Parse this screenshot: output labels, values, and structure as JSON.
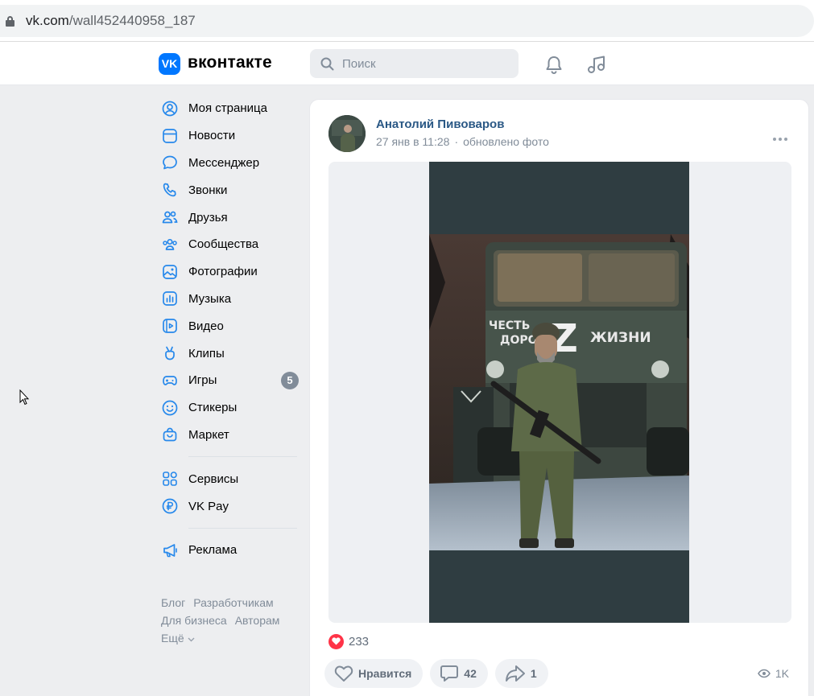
{
  "browser": {
    "url_host": "vk.com",
    "url_path": "/wall452440958_187"
  },
  "header": {
    "logo_letter": "VK",
    "brand": "вконтакте",
    "search_placeholder": "Поиск",
    "accent_color": "#0077ff"
  },
  "sidebar": {
    "items": [
      {
        "label": "Моя страница",
        "icon": "user-circle-icon"
      },
      {
        "label": "Новости",
        "icon": "newsfeed-icon"
      },
      {
        "label": "Мессенджер",
        "icon": "message-icon"
      },
      {
        "label": "Звонки",
        "icon": "phone-icon"
      },
      {
        "label": "Друзья",
        "icon": "friends-icon"
      },
      {
        "label": "Сообщества",
        "icon": "communities-icon"
      },
      {
        "label": "Фотографии",
        "icon": "photo-icon"
      },
      {
        "label": "Музыка",
        "icon": "music-icon"
      },
      {
        "label": "Видео",
        "icon": "video-icon"
      },
      {
        "label": "Клипы",
        "icon": "clips-icon"
      },
      {
        "label": "Игры",
        "icon": "gamepad-icon",
        "badge": "5"
      },
      {
        "label": "Стикеры",
        "icon": "smile-icon"
      },
      {
        "label": "Маркет",
        "icon": "bag-icon"
      }
    ],
    "items2": [
      {
        "label": "Сервисы",
        "icon": "services-icon"
      },
      {
        "label": "VK Pay",
        "icon": "ruble-icon"
      }
    ],
    "items3": [
      {
        "label": "Реклама",
        "icon": "megaphone-icon"
      }
    ],
    "footer": {
      "blog": "Блог",
      "developers": "Разработчикам",
      "business": "Для бизнеса",
      "authors": "Авторам",
      "more": "Ещё"
    }
  },
  "post": {
    "author": "Анатолий Пивоваров",
    "date": "27 янв в 11:28",
    "dot": "·",
    "update_note": "обновлено фото",
    "truck_text_line1": "ЧЕСТЬ",
    "truck_text_line2": "ДОРО",
    "truck_text_z": "Z",
    "truck_text_right": "ЖИЗНИ",
    "reactions_count": "233",
    "like_label": "Нравится",
    "comments_count": "42",
    "shares_count": "1",
    "views_count": "1K",
    "reaction_color": "#ff3347",
    "link_color": "#2a5885"
  }
}
